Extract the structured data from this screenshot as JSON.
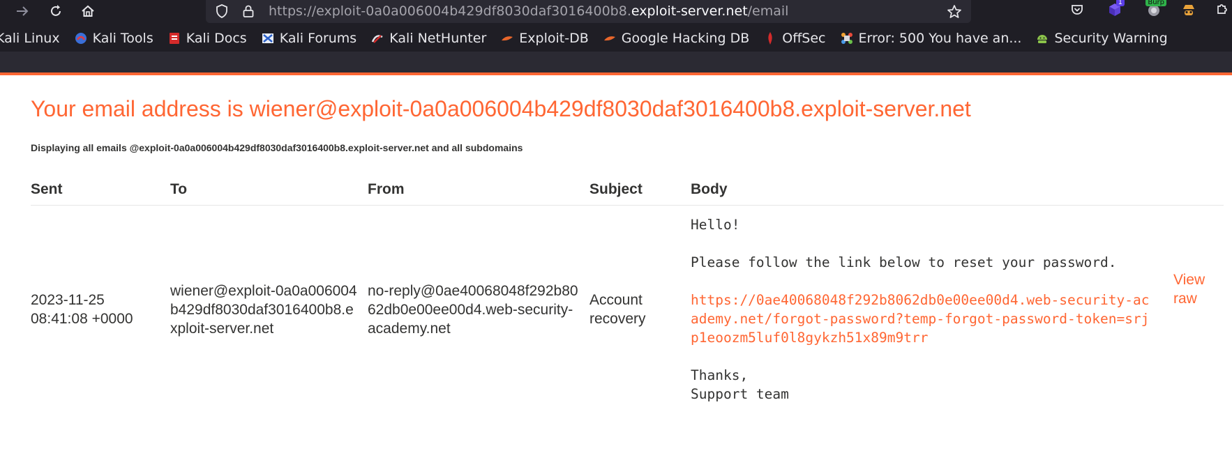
{
  "browser": {
    "url_prefix": "https://exploit-0a0a006004b429df8030daf3016400b8.",
    "url_host": "exploit-server.net",
    "url_path": "/email",
    "extensions": [
      {
        "name": "email",
        "badge": ""
      },
      {
        "name": "extension",
        "badge": "1"
      },
      {
        "name": "burp",
        "badge": "Burp"
      },
      {
        "name": "spy",
        "badge": ""
      }
    ]
  },
  "bookmarks": [
    {
      "label": "Kali Linux",
      "icon": "kali-icon"
    },
    {
      "label": "Kali Tools",
      "icon": "kali-tools-icon"
    },
    {
      "label": "Kali Docs",
      "icon": "kali-docs-icon"
    },
    {
      "label": "Kali Forums",
      "icon": "kali-forums-icon"
    },
    {
      "label": "Kali NetHunter",
      "icon": "nethunter-icon"
    },
    {
      "label": "Exploit-DB",
      "icon": "exploitdb-icon"
    },
    {
      "label": "Google Hacking DB",
      "icon": "ghdb-icon"
    },
    {
      "label": "OffSec",
      "icon": "offsec-icon"
    },
    {
      "label": "Error: 500 You have an...",
      "icon": "joomla-icon"
    },
    {
      "label": "Security Warning",
      "icon": "android-icon"
    }
  ],
  "page": {
    "title": "Your email address is wiener@exploit-0a0a006004b429df8030daf3016400b8.exploit-server.net",
    "subtitle": "Displaying all emails @exploit-0a0a006004b429df8030daf3016400b8.exploit-server.net and all subdomains",
    "columns": [
      "Sent",
      "To",
      "From",
      "Subject",
      "Body"
    ],
    "emails": [
      {
        "sent": "2023-11-25 08:41:08 +0000",
        "to": "wiener@exploit-0a0a006004b429df8030daf3016400b8.exploit-server.net",
        "from": "no-reply@0ae40068048f292b8062db0e00ee00d4.web-security-academy.net",
        "subject": "Account recovery",
        "body_greeting": "Hello!",
        "body_intro": "Please follow the link below to reset your password.",
        "body_link": "https://0ae40068048f292b8062db0e00ee00d4.web-security-academy.net/forgot-password?temp-forgot-password-token=srjp1eoozm5luf0l8gykzh51x89m9trr",
        "body_signoff": "Thanks,\nSupport team",
        "view_raw": "View raw"
      }
    ]
  },
  "colors": {
    "accent": "#ff6633",
    "text": "#333332",
    "chrome_bg": "#1f1e25",
    "urlbar_bg": "#2b2a33"
  }
}
